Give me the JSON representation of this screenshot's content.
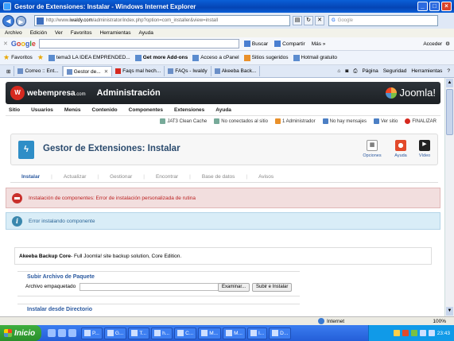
{
  "window": {
    "title": "Gestor de Extensiones: Instalar - Windows Internet Explorer"
  },
  "address": {
    "url_prefix": "http://www.",
    "url_host": "iwaldy.com",
    "url_rest": "/administrator/index.php?option=com_installer&view=install",
    "search_placeholder": "Google"
  },
  "menubar": [
    "Archivo",
    "Edición",
    "Ver",
    "Favoritos",
    "Herramientas",
    "Ayuda"
  ],
  "google_toolbar": {
    "buscar": "Buscar",
    "compartir": "Compartir",
    "mas": "Más »",
    "acceder": "Acceder"
  },
  "favorites": {
    "label": "Favoritos",
    "items": [
      "tema3 LA IDEA EMPRENDED...",
      "Get more Add-ons",
      "Acceso a cPanel",
      "Sitios sugeridos",
      "Hotmail gratuito"
    ]
  },
  "tabs": [
    "Correo :: Ent...",
    "Gestor de...",
    "Faqs mal hech...",
    "FAQs - Iwaldy",
    "Akeeba Back..."
  ],
  "commandbar": {
    "pagina": "Página",
    "seguridad": "Seguridad",
    "herramientas": "Herramientas"
  },
  "joomla": {
    "brand": "webempresa",
    "brand_suffix": ".com",
    "admin_title": "Administración",
    "joomla_logo": "Joomla!",
    "menu": [
      "Sitio",
      "Usuarios",
      "Menús",
      "Contenido",
      "Componentes",
      "Extensiones",
      "Ayuda"
    ],
    "status": [
      "JAT3 Clean Cache",
      "No conectados al sitio",
      "1 Administrador",
      "No hay mensajes",
      "Ver sitio",
      "FINALIZAR"
    ],
    "page_title": "Gestor de Extensiones: Instalar",
    "toolbar": [
      {
        "label": "Opciones"
      },
      {
        "label": "Ayuda"
      },
      {
        "label": "Vídeo"
      }
    ],
    "subtabs": [
      "Instalar",
      "Actualizar",
      "Gestionar",
      "Encontrar",
      "Base de datos",
      "Avisos"
    ],
    "error_msg": "Instalación de componentes: Error de instalación personalizada de rutina",
    "info_msg": "Error instalando componente",
    "akeeba_title": "Akeeba Backup Core",
    "akeeba_desc": " - Full Joomla! site backup solution, Core Edition.",
    "upload": {
      "legend": "Subir Archivo de Paquete",
      "label": "Archivo empaquetado",
      "browse": "Examinar...",
      "submit": "Subir e Instalar"
    },
    "dir_legend": "Instalar desde Directorio"
  },
  "statusbar": {
    "zone": "Internet",
    "zoom": "100%"
  },
  "taskbar": {
    "start": "Inicio",
    "items": [
      "P...",
      "G...",
      "T...",
      "h...",
      "C...",
      "M...",
      "M...",
      "I...",
      "D..."
    ],
    "time": "23:43"
  },
  "colors": {
    "title_bar": "#0a5fd8",
    "joomla_header": "#2e343a",
    "error_bg": "#f2dede",
    "info_bg": "#d9edf7",
    "taskbar": "#245ed8",
    "start": "#2b8f2b"
  }
}
